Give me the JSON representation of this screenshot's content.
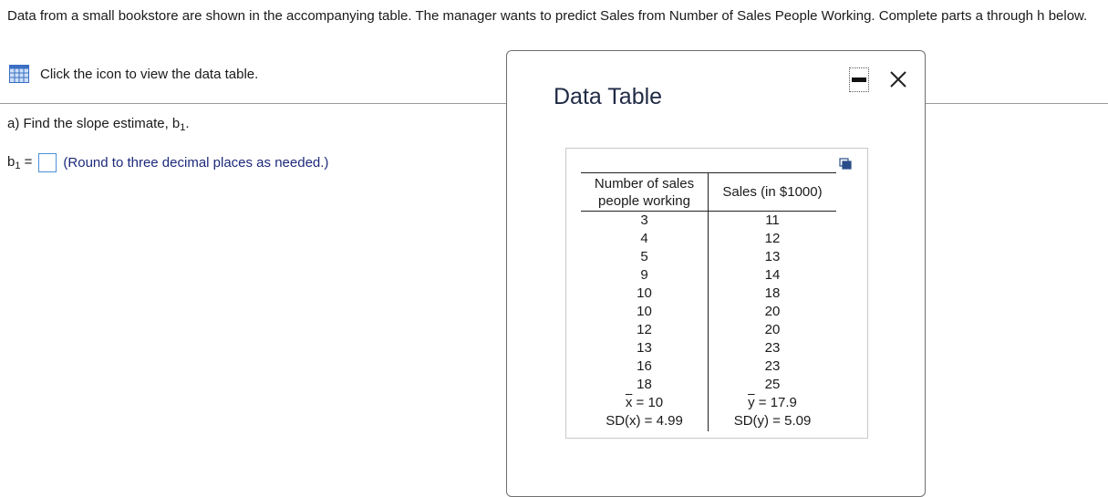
{
  "question": {
    "intro": "Data from a small bookstore are shown in the accompanying table. The manager wants to predict Sales from Number of Sales People Working. Complete parts a through h below.",
    "data_link": "Click the icon to view the data table.",
    "part_a_prefix": "a) Find the slope estimate, b",
    "part_a_sub": "1",
    "part_a_suffix": ".",
    "answer_label": "b",
    "answer_sub": "1",
    "answer_eq": " =",
    "answer_value": "",
    "hint": "(Round to three decimal places as needed.)"
  },
  "modal": {
    "title": "Data Table",
    "col_x_header": "Number of sales people working",
    "col_y_header": "Sales (in $1000)",
    "x_values": [
      "3",
      "4",
      "5",
      "9",
      "10",
      "10",
      "12",
      "13",
      "16",
      "18"
    ],
    "y_values": [
      "11",
      "12",
      "13",
      "14",
      "18",
      "20",
      "20",
      "23",
      "23",
      "25"
    ],
    "x_mean_var": "x",
    "x_mean_val": " = 10",
    "y_mean_var": "y",
    "y_mean_val": " = 17.9",
    "x_sd": "SD(x) = 4.99",
    "y_sd": "SD(y) = 5.09"
  }
}
